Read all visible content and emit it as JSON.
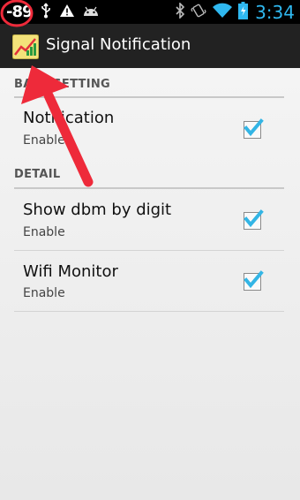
{
  "status_bar": {
    "signal_dbm": "-89",
    "time": "3:34",
    "icons": [
      "usb-icon",
      "warning-icon",
      "android-icon",
      "bluetooth-icon",
      "vibrate-icon",
      "wifi-icon",
      "battery-charging-icon"
    ]
  },
  "action_bar": {
    "title": "Signal Notification",
    "icon": "app-icon"
  },
  "sections": [
    {
      "header": "BASE SETTING",
      "items": [
        {
          "title": "Notification",
          "subtitle": "Enable",
          "checked": true
        }
      ]
    },
    {
      "header": "DETAIL",
      "items": [
        {
          "title": "Show dbm by digit",
          "subtitle": "Enable",
          "checked": true
        },
        {
          "title": "Wifi Monitor",
          "subtitle": "Enable",
          "checked": true
        }
      ]
    }
  ],
  "colors": {
    "accent": "#33b5e5",
    "annotation": "#ee2a3a",
    "status_bar_bg": "#000000",
    "action_bar_bg": "#222222"
  }
}
